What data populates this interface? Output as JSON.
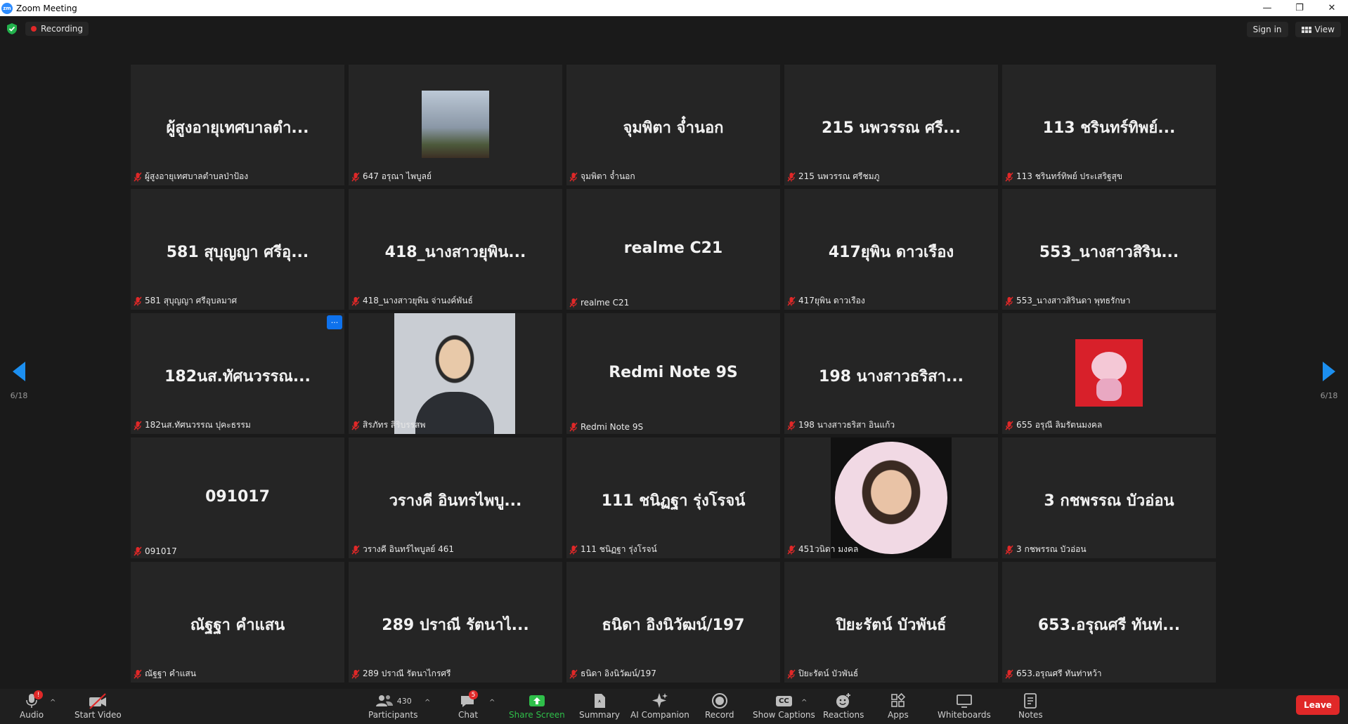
{
  "window": {
    "title": "Zoom Meeting",
    "app_badge": "zm",
    "minimize": "—",
    "restore": "❐",
    "close": "✕"
  },
  "topbar": {
    "recording_label": "Recording",
    "signin_label": "Sign in",
    "view_label": "View"
  },
  "pager": {
    "left": "6/18",
    "right": "6/18"
  },
  "tiles": [
    {
      "big": "ผู้สูงอายุเทศบาลตำ...",
      "label": "ผู้สูงอายุเทศบาลตำบลป่าป้อง",
      "photo": ""
    },
    {
      "big": "",
      "label": "647 อรุณา ไพบูลย์",
      "photo": "p1"
    },
    {
      "big": "จุมพิตา จ๋ำนอก",
      "label": "จุมพิตา จ๋ำนอก",
      "photo": ""
    },
    {
      "big": "215 นพวรรณ ศรี...",
      "label": "215 นพวรรณ ศรีชมภู",
      "photo": ""
    },
    {
      "big": "113 ชรินทร์ทิพย์...",
      "label": "113 ชรินทร์ทิพย์ ประเสริฐสุข",
      "photo": ""
    },
    {
      "big": "581 สุบุญญา ศรีอุ...",
      "label": "581 สุบุญญา ศรีอุบลมาศ",
      "photo": ""
    },
    {
      "big": "418_นางสาวยุพิน...",
      "label": "418_นางสาวยุพิน จ่านงค์พันธ์",
      "photo": ""
    },
    {
      "big": "realme C21",
      "label": "realme C21",
      "photo": ""
    },
    {
      "big": "417ยุพิน ดาวเรือง",
      "label": "417ยุพิน ดาวเรือง",
      "photo": ""
    },
    {
      "big": "553_นางสาวสิริน...",
      "label": "553_นางสาวสิรินดา พุทธรักษา",
      "photo": ""
    },
    {
      "big": "182นส.ทัศนวรรณ...",
      "label": "182นส.ทัศนวรรณ ปุคะธรรม",
      "photo": "",
      "more": "···"
    },
    {
      "big": "",
      "label": "สิรภัทร สิริบรรสพ",
      "photo": "p2"
    },
    {
      "big": "Redmi Note 9S",
      "label": "Redmi Note 9S",
      "photo": ""
    },
    {
      "big": "198 นางสาวธริสา...",
      "label": "198 นางสาวธริสา อินแก้ว",
      "photo": ""
    },
    {
      "big": "",
      "label": "655 อรุณี ลิมรัตนมงคล",
      "photo": "p3"
    },
    {
      "big": "091017",
      "label": "091017",
      "photo": ""
    },
    {
      "big": "วรางคี อินทรไพบู...",
      "label": "วรางคี อินทร์ไพบูลย์ 461",
      "photo": ""
    },
    {
      "big": "111 ชนิฏฐา รุ่งโรจน์",
      "label": "111 ชนิฏฐา รุ่งโรจน์",
      "photo": ""
    },
    {
      "big": "",
      "label": "451วนิดา มงคล",
      "photo": "p4"
    },
    {
      "big": "3 กชพรรณ บัวอ่อน",
      "label": "3 กชพรรณ บัวอ่อน",
      "photo": ""
    },
    {
      "big": "ณัฐฐา คำแสน",
      "label": "ณัฐฐา คำแสน",
      "photo": ""
    },
    {
      "big": "289 ปราณี รัตนาไ...",
      "label": "289 ปราณี รัตนาไกรศรี",
      "photo": ""
    },
    {
      "big": "ธนิดา อิงนิวัฒน์/197",
      "label": "ธนิดา อิงนิวัฒน์/197",
      "photo": ""
    },
    {
      "big": "ปิยะรัตน์ บัวพันธ์",
      "label": "ปิยะรัตน์ บัวพันธ์",
      "photo": ""
    },
    {
      "big": "653.อรุณศรี ทันท่...",
      "label": "653.อรุณศรี ทันท่าหว้า",
      "photo": ""
    }
  ],
  "toolbar": {
    "audio": "Audio",
    "audio_badge": "!",
    "video": "Start Video",
    "participants": "Participants",
    "participants_count": "430",
    "chat": "Chat",
    "chat_badge": "5",
    "share": "Share Screen",
    "summary": "Summary",
    "ai": "AI Companion",
    "record": "Record",
    "captions": "Show Captions",
    "captions_glyph": "CC",
    "reactions": "Reactions",
    "apps": "Apps",
    "whiteboards": "Whiteboards",
    "notes": "Notes",
    "leave": "Leave"
  },
  "colors": {
    "accent": "#1c8ff0",
    "danger": "#e02828",
    "share": "#2fbf4a",
    "tile": "#252525",
    "background": "#1a1a1a"
  }
}
